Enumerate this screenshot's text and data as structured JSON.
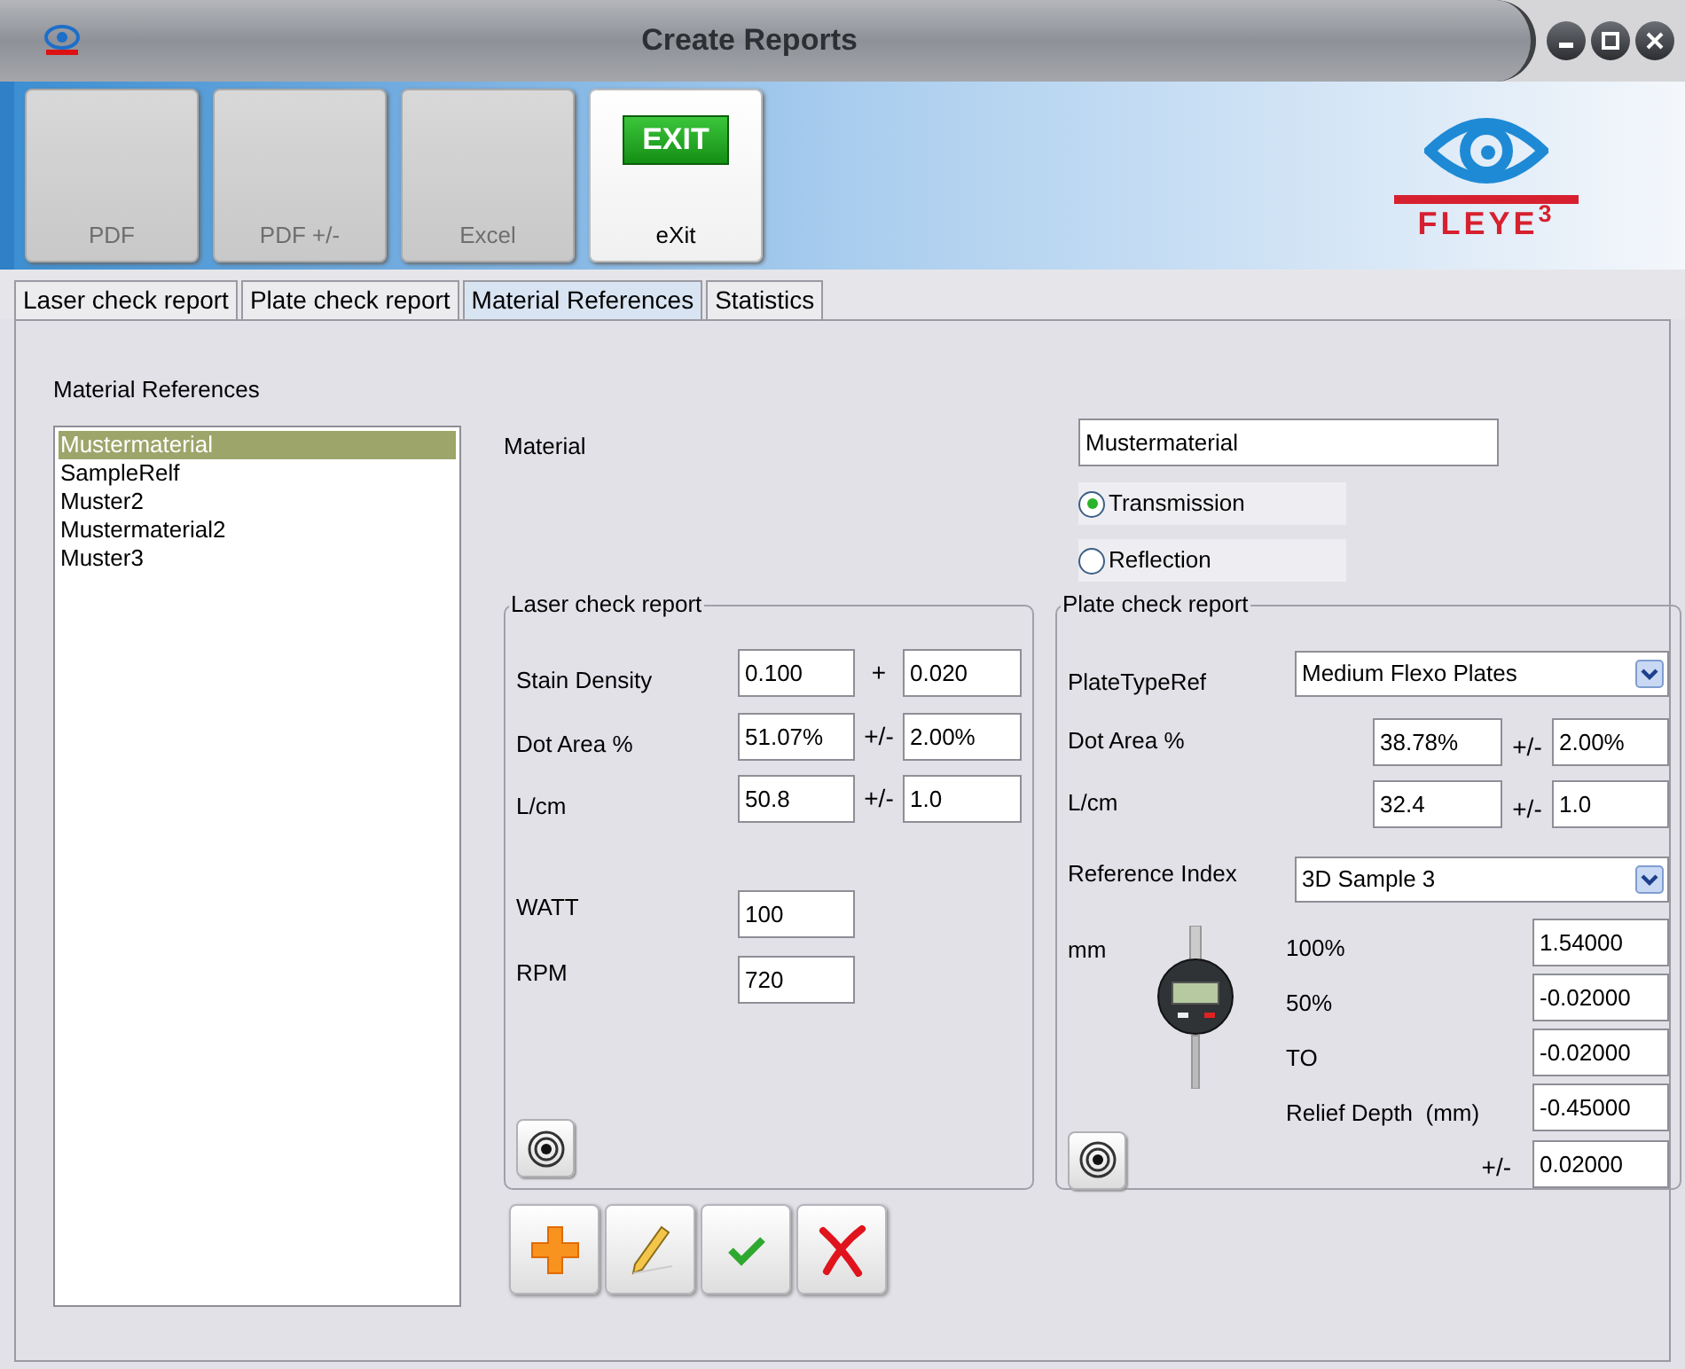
{
  "window": {
    "title": "Create Reports"
  },
  "toolbar": {
    "buttons": [
      {
        "kind": "document",
        "label": "PDF",
        "disabled": true
      },
      {
        "kind": "document",
        "label": "PDF +/-",
        "disabled": true
      },
      {
        "kind": "document",
        "label": "Excel",
        "disabled": true
      },
      {
        "kind": "exit",
        "label": "eXit",
        "sign": "EXIT",
        "disabled": false
      }
    ]
  },
  "logo": {
    "text": "FLEYE$^{3}$"
  },
  "tabs": [
    {
      "label": "Laser check report",
      "selected": false
    },
    {
      "label": "Plate check report",
      "selected": false
    },
    {
      "label": "Material References",
      "selected": true
    },
    {
      "label": "Statistics",
      "selected": false
    }
  ],
  "material_references": {
    "title": "Material References",
    "items": [
      {
        "label": "Mustermaterial",
        "selected": true
      },
      {
        "label": "SampleRelf",
        "selected": false
      },
      {
        "label": "Muster2",
        "selected": false
      },
      {
        "label": "Mustermaterial2",
        "selected": false
      },
      {
        "label": "Muster3",
        "selected": false
      }
    ]
  },
  "material": {
    "label": "Material",
    "value": "Mustermaterial",
    "modes": [
      {
        "label": "Transmission",
        "selected": true
      },
      {
        "label": "Reflection",
        "selected": false
      }
    ]
  },
  "laser_check_report": {
    "title": "Laser check report",
    "rows": [
      {
        "label": "Stain Density",
        "value": "0.100",
        "separator": "+",
        "tolerance": "0.020"
      },
      {
        "label": "Dot Area %",
        "value": "51.07%",
        "separator": "+/-",
        "tolerance": "2.00%"
      },
      {
        "label": "L/cm",
        "value": "50.8",
        "separator": "+/-",
        "tolerance": "1.0"
      }
    ],
    "settings": [
      {
        "label": "WATT",
        "value": "100"
      },
      {
        "label": "RPM",
        "value": "720"
      }
    ]
  },
  "plate_check_report": {
    "title": "Plate check report",
    "plate_type": {
      "label": "PlateTypeRef",
      "value": "Medium Flexo Plates"
    },
    "rows": [
      {
        "label": "Dot Area %",
        "value": "38.78%",
        "separator": "+/-",
        "tolerance": "2.00%"
      },
      {
        "label": "L/cm",
        "value": "32.4",
        "separator": "+/-",
        "tolerance": "1.0"
      }
    ],
    "reference_index": {
      "label": "Reference Index",
      "value": "3D Sample 3"
    },
    "unit": "mm",
    "measurements": [
      {
        "label": "100%",
        "value": "1.54000"
      },
      {
        "label": "50%",
        "value": "-0.02000"
      },
      {
        "label": "TO",
        "value": "-0.02000"
      },
      {
        "label": "Relief Depth  (mm)",
        "value": "-0.45000"
      }
    ],
    "tolerance": {
      "label": "+/-",
      "value": "0.02000"
    }
  },
  "actions": [
    {
      "kind": "add"
    },
    {
      "kind": "edit"
    },
    {
      "kind": "confirm"
    },
    {
      "kind": "delete"
    }
  ]
}
